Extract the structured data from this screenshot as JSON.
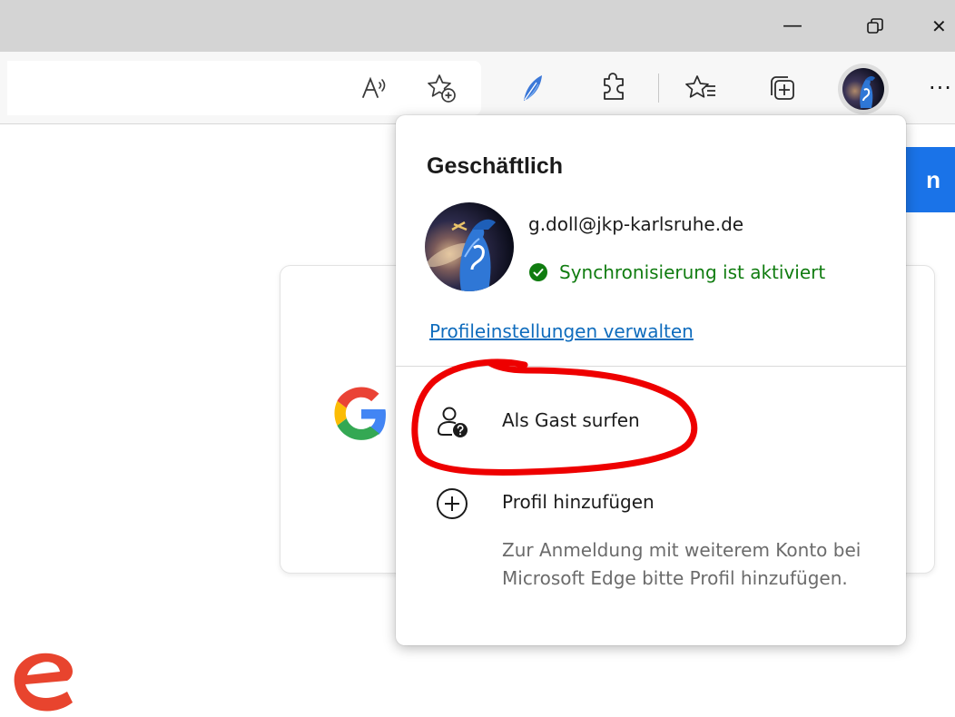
{
  "window_controls": {
    "minimize_glyph": "—",
    "restore_glyph": "⧉",
    "close_glyph": "✕"
  },
  "toolbar": {
    "icons": [
      "read-aloud-icon",
      "add-favorite-icon",
      "feather-extension-icon",
      "extensions-icon",
      "favorites-icon",
      "collections-icon"
    ],
    "ellipsis": "···"
  },
  "page": {
    "blue_button_fragment": "n"
  },
  "profile_popup": {
    "title": "Geschäftlich",
    "email": "g.doll@jkp-karlsruhe.de",
    "sync_status": "Synchronisierung ist aktiviert",
    "manage_link": "Profileinstellungen verwalten",
    "guest_label": "Als Gast surfen",
    "add_profile_label": "Profil hinzufügen",
    "add_profile_description": "Zur Anmeldung mit weiterem Konto bei Microsoft Edge bitte Profil hinzufügen."
  },
  "colors": {
    "sync_green": "#107c10",
    "link_blue": "#0f6cbd",
    "annotation_red": "#ee0000",
    "edge_logo_red": "#e8442e"
  }
}
